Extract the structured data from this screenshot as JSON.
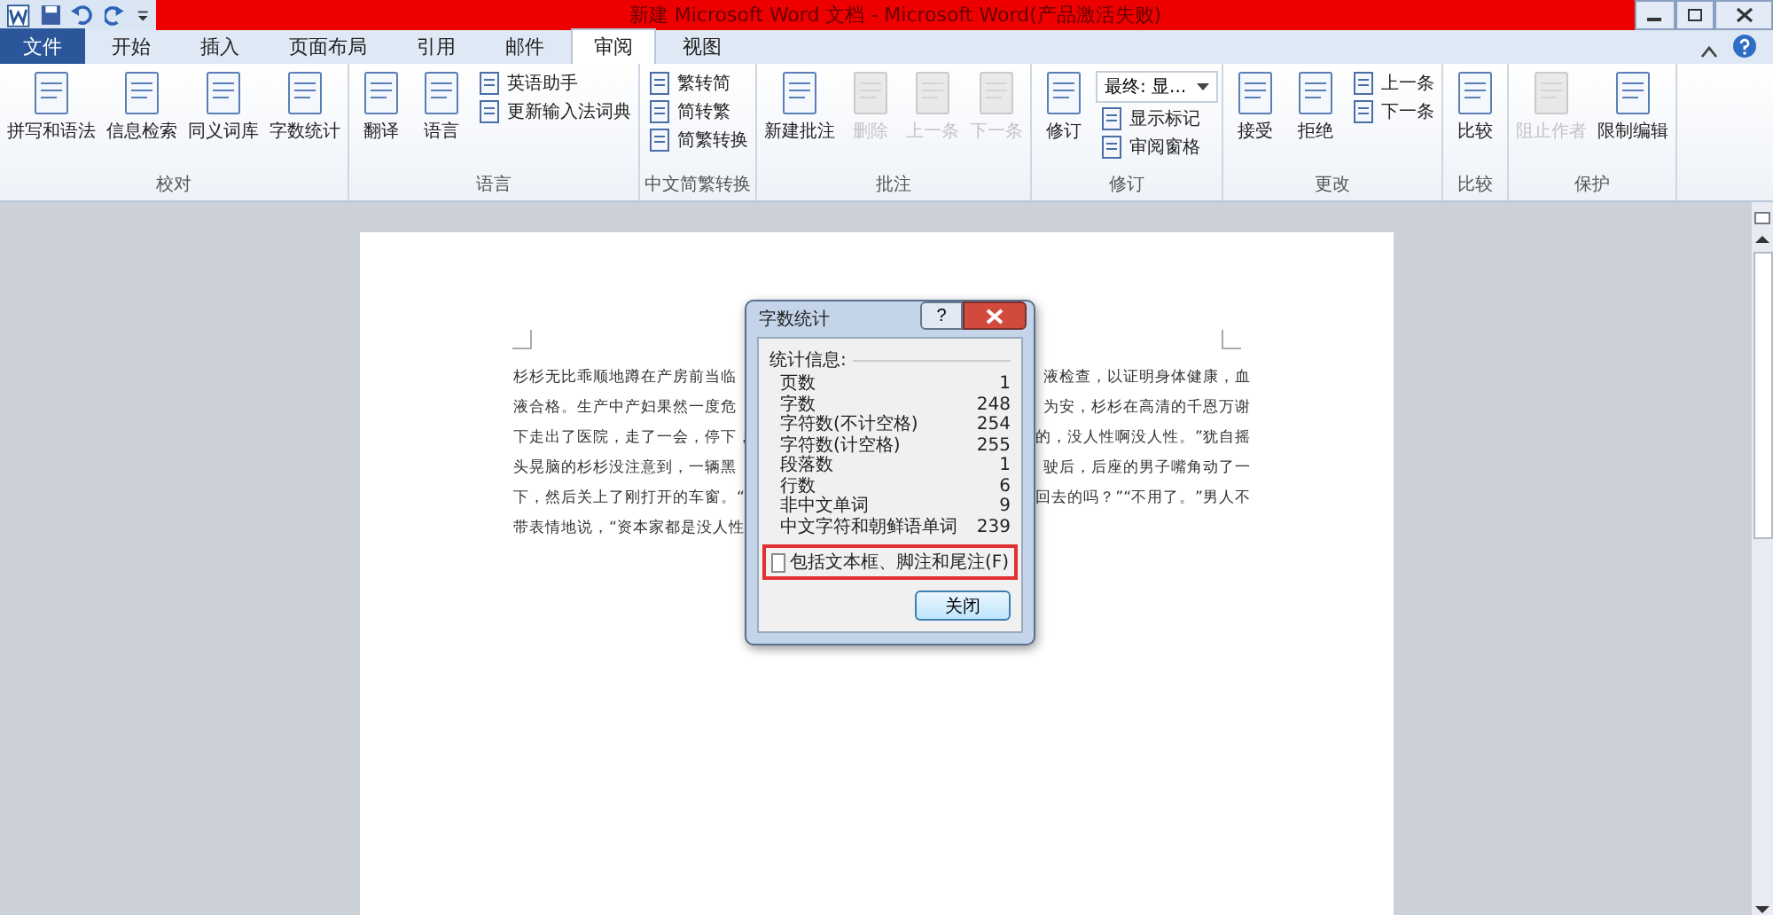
{
  "window": {
    "title": "新建 Microsoft Word 文档 - Microsoft Word(产品激活失败)"
  },
  "tabs": [
    {
      "label": "文件",
      "kind": "file",
      "selected": false
    },
    {
      "label": "开始",
      "kind": "tab",
      "selected": false
    },
    {
      "label": "插入",
      "kind": "tab",
      "selected": false
    },
    {
      "label": "页面布局",
      "kind": "tab",
      "selected": false
    },
    {
      "label": "引用",
      "kind": "tab",
      "selected": false
    },
    {
      "label": "邮件",
      "kind": "tab",
      "selected": false
    },
    {
      "label": "审阅",
      "kind": "tab",
      "selected": true
    },
    {
      "label": "视图",
      "kind": "tab",
      "selected": false
    }
  ],
  "ribbon": {
    "groups": [
      {
        "label": "校对",
        "items": [
          {
            "label": "拼写和语法",
            "kind": "large",
            "disabled": false
          },
          {
            "label": "信息检索",
            "kind": "large",
            "disabled": false
          },
          {
            "label": "同义词库",
            "kind": "large",
            "disabled": false
          },
          {
            "label": "字数统计",
            "kind": "large",
            "disabled": false
          }
        ]
      },
      {
        "label": "语言",
        "items": [
          {
            "label": "翻译",
            "kind": "large",
            "disabled": false
          },
          {
            "label": "语言",
            "kind": "large",
            "disabled": false
          },
          {
            "label": "英语助手",
            "kind": "small",
            "disabled": false
          },
          {
            "label": "更新输入法词典",
            "kind": "small",
            "disabled": false
          }
        ]
      },
      {
        "label": "中文简繁转换",
        "items": [
          {
            "label": "繁转简",
            "kind": "small",
            "disabled": false
          },
          {
            "label": "简转繁",
            "kind": "small",
            "disabled": false
          },
          {
            "label": "简繁转换",
            "kind": "small",
            "disabled": false
          }
        ]
      },
      {
        "label": "批注",
        "items": [
          {
            "label": "新建批注",
            "kind": "large",
            "disabled": false
          },
          {
            "label": "删除",
            "kind": "large",
            "disabled": true
          },
          {
            "label": "上一条",
            "kind": "large",
            "disabled": true
          },
          {
            "label": "下一条",
            "kind": "large",
            "disabled": true
          }
        ]
      },
      {
        "label": "修订",
        "items": [
          {
            "label": "修订",
            "kind": "large",
            "disabled": false
          },
          {
            "label": "最终: 显...",
            "kind": "dropdown"
          },
          {
            "label": "显示标记",
            "kind": "small",
            "disabled": false
          },
          {
            "label": "审阅窗格",
            "kind": "small",
            "disabled": false
          }
        ]
      },
      {
        "label": "更改",
        "items": [
          {
            "label": "接受",
            "kind": "large",
            "disabled": false
          },
          {
            "label": "拒绝",
            "kind": "large",
            "disabled": false
          },
          {
            "label": "上一条",
            "kind": "small",
            "disabled": false
          },
          {
            "label": "下一条",
            "kind": "small",
            "disabled": false
          }
        ]
      },
      {
        "label": "比较",
        "items": [
          {
            "label": "比较",
            "kind": "large",
            "disabled": false
          }
        ]
      },
      {
        "label": "保护",
        "items": [
          {
            "label": "阻止作者",
            "kind": "large",
            "disabled": true
          },
          {
            "label": "限制编辑",
            "kind": "large",
            "disabled": false
          }
        ]
      }
    ]
  },
  "document": {
    "lines": [
      {
        "left": "杉杉无比乖顺地蹲在产房前当临",
        "right": "液检查，以证明身体健康，血"
      },
      {
        "left": "液合格。生产中产妇果然一度危",
        "right": "为安，杉杉在高清的千恩万谢"
      },
      {
        "left": "下走出了医院，走了一会，停下，",
        "right": "的，没人性啊没人性。”犹自摇"
      },
      {
        "left": "头晃脑的杉杉没注意到，一辆黑",
        "right": "驶后，后座的男子嘴角动了一"
      },
      {
        "left": "下，然后关上了刚打开的车窗。“",
        "right": "回去的吗？”“不用了。”男人不"
      },
      {
        "left": "带表情地说，“资本家都是没人性"
      }
    ]
  },
  "dialog": {
    "title": "字数统计",
    "help": "?",
    "section": "统计信息:",
    "stats": [
      {
        "label": "页数",
        "value": "1"
      },
      {
        "label": "字数",
        "value": "248"
      },
      {
        "label": "字符数(不计空格)",
        "value": "254"
      },
      {
        "label": "字符数(计空格)",
        "value": "255"
      },
      {
        "label": "段落数",
        "value": "1"
      },
      {
        "label": "行数",
        "value": "6"
      },
      {
        "label": "非中文单词",
        "value": "9"
      },
      {
        "label": "中文字符和朝鲜语单词",
        "value": "239"
      }
    ],
    "checkbox": {
      "label": "包括文本框、脚注和尾注(F)",
      "checked": false,
      "highlighted": true
    },
    "button": "关闭"
  }
}
